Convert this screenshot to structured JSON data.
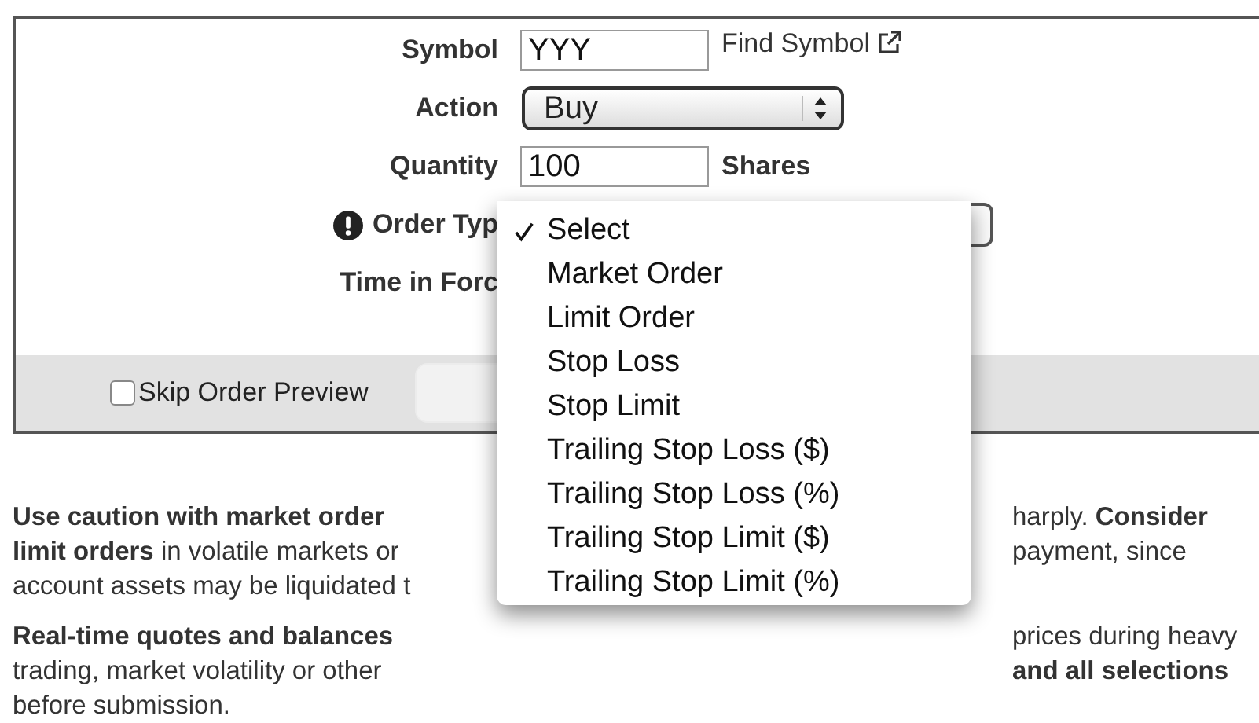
{
  "form": {
    "fields": [
      {
        "kind": "input",
        "label": "Symbol",
        "value": "YYY",
        "link": "Find Symbol"
      },
      {
        "kind": "select",
        "label": "Action",
        "value": "Buy"
      },
      {
        "kind": "input",
        "label": "Quantity",
        "value": "100",
        "suffix": "Shares"
      },
      {
        "kind": "select",
        "label": "Order Typ",
        "alert": true
      },
      {
        "kind": "select",
        "label": "Time in Forc"
      }
    ],
    "skip_preview": {
      "label": "Skip Order Preview",
      "checked": false
    }
  },
  "dropdown": {
    "items": [
      {
        "label": "Select",
        "selected": true
      },
      {
        "label": "Market Order",
        "selected": false
      },
      {
        "label": "Limit Order",
        "selected": false
      },
      {
        "label": "Stop Loss",
        "selected": false
      },
      {
        "label": "Stop Limit",
        "selected": false
      },
      {
        "label": "Trailing Stop Loss ($)",
        "selected": false
      },
      {
        "label": "Trailing Stop Loss (%)",
        "selected": false
      },
      {
        "label": "Trailing Stop Limit ($)",
        "selected": false
      },
      {
        "label": "Trailing Stop Limit (%)",
        "selected": false
      }
    ]
  },
  "notes": [
    {
      "lines": [
        {
          "left": "**Use caution with market order**",
          "right": "harply. **Consider**"
        },
        {
          "left": "**limit orders** in volatile markets or",
          "right": "payment, since"
        },
        {
          "left": "account assets may be liquidated t"
        }
      ]
    },
    {
      "lines": [
        {
          "left": "**Real-time quotes and balances**",
          "right": "prices during heavy"
        },
        {
          "left": "trading, market volatility or other",
          "right": "**and all selections**"
        },
        {
          "left": "before submission."
        }
      ]
    }
  ]
}
